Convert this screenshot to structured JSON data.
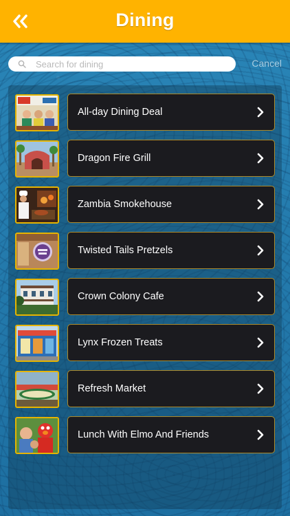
{
  "header": {
    "title": "Dining",
    "back_icon": "double-chevron-left-icon"
  },
  "search": {
    "placeholder": "Search for dining",
    "value": "",
    "cancel_label": "Cancel"
  },
  "colors": {
    "header": "#ffb300",
    "background": "#2a86b8",
    "card": "#1b1b1f",
    "thumb_border": "#e6b400"
  },
  "items": [
    {
      "label": "All-day Dining Deal",
      "thumb": "dining-deal-photo"
    },
    {
      "label": "Dragon Fire Grill",
      "thumb": "restaurant-exterior-photo"
    },
    {
      "label": "Zambia Smokehouse",
      "thumb": "chef-grill-photo"
    },
    {
      "label": "Twisted Tails Pretzels",
      "thumb": "pretzel-shop-photo"
    },
    {
      "label": "Crown Colony Cafe",
      "thumb": "cafe-building-photo"
    },
    {
      "label": "Lynx Frozen Treats",
      "thumb": "frozen-treats-shop-photo"
    },
    {
      "label": "Refresh Market",
      "thumb": "market-sign-photo"
    },
    {
      "label": "Lunch With Elmo And Friends",
      "thumb": "elmo-friends-photo"
    }
  ]
}
